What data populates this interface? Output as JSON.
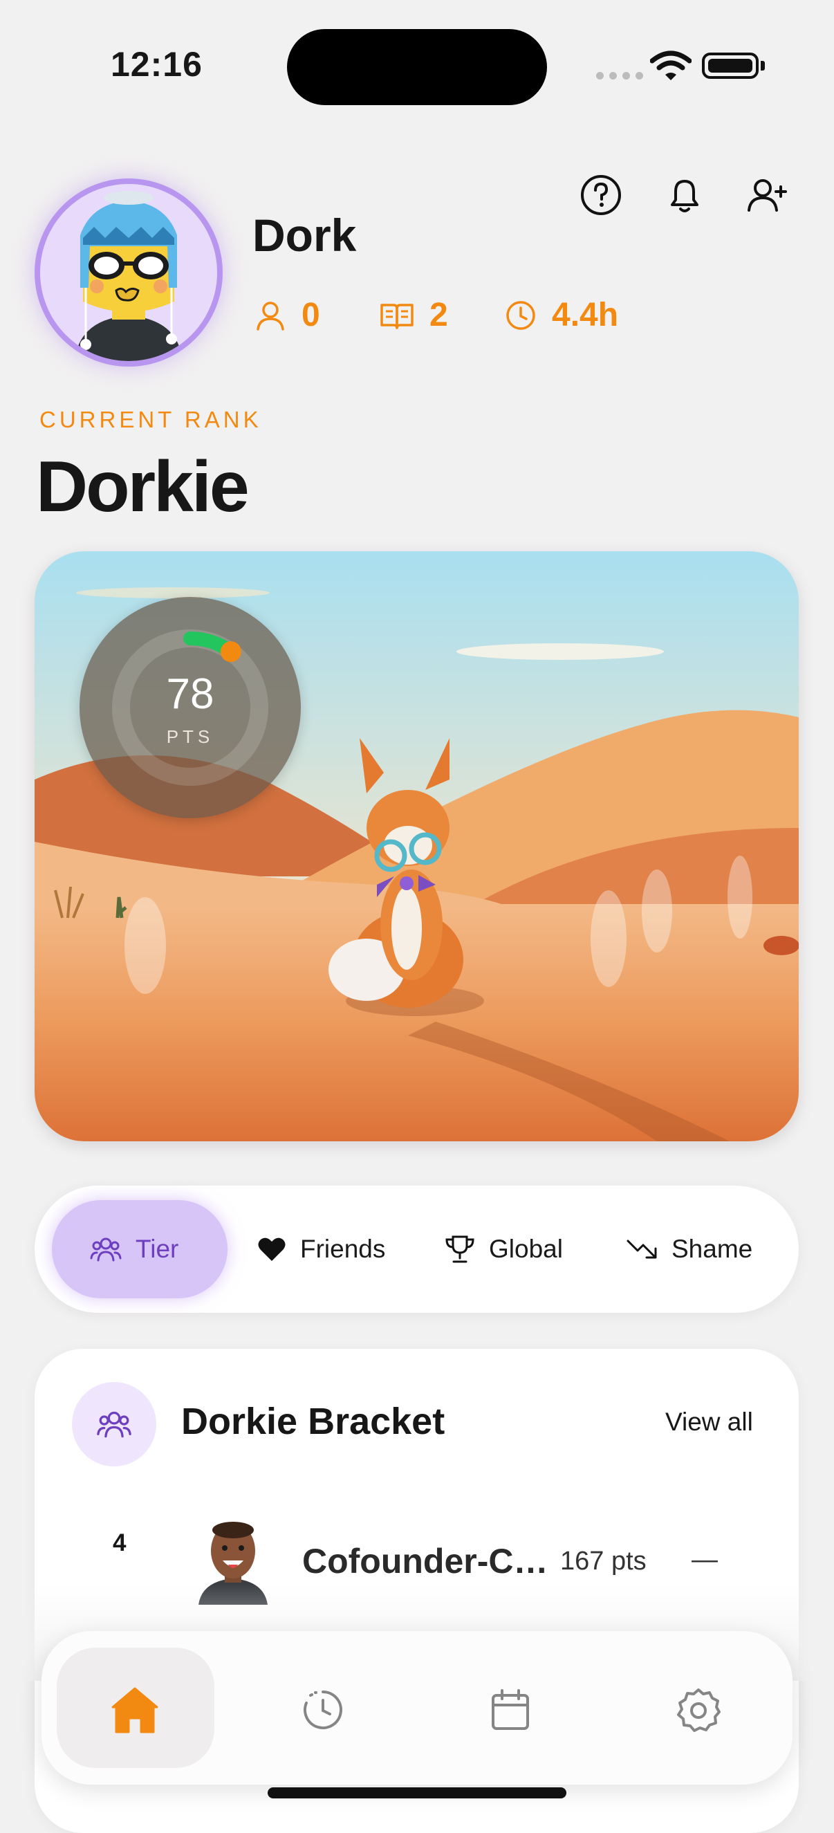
{
  "status_bar": {
    "time": "12:16"
  },
  "header": {
    "icons": [
      "help-circle-icon",
      "bell-icon",
      "add-friend-icon"
    ],
    "user_name": "Dork",
    "stats": [
      {
        "icon": "user-icon",
        "value": "0"
      },
      {
        "icon": "book-icon",
        "value": "2"
      },
      {
        "icon": "clock-icon",
        "value": "4.4h"
      }
    ]
  },
  "rank": {
    "caption": "CURRENT RANK",
    "name": "Dorkie"
  },
  "hero": {
    "points_value": "78",
    "points_unit": "PTS",
    "progress_fraction": 0.1
  },
  "tabs": [
    {
      "label": "Tier",
      "icon": "users-icon",
      "active": true
    },
    {
      "label": "Friends",
      "icon": "heart-icon",
      "active": false
    },
    {
      "label": "Global",
      "icon": "trophy-icon",
      "active": false
    },
    {
      "label": "Shame",
      "icon": "trending-down-icon",
      "active": false
    }
  ],
  "bracket": {
    "title": "Dorkie Bracket",
    "view_all": "View all",
    "entries": [
      {
        "rank": "4",
        "name": "Cofounder-Cyr...",
        "points": "167 pts",
        "trend": "—"
      }
    ]
  },
  "bottom_nav": [
    {
      "icon": "home-icon",
      "active": true
    },
    {
      "icon": "history-icon",
      "active": false
    },
    {
      "icon": "calendar-icon",
      "active": false
    },
    {
      "icon": "settings-icon",
      "active": false
    }
  ],
  "colors": {
    "accent": "#f28a12",
    "tier_active": "#d8c5f7",
    "avatar_ring": "#b895ee",
    "progress": "#22c55e"
  }
}
